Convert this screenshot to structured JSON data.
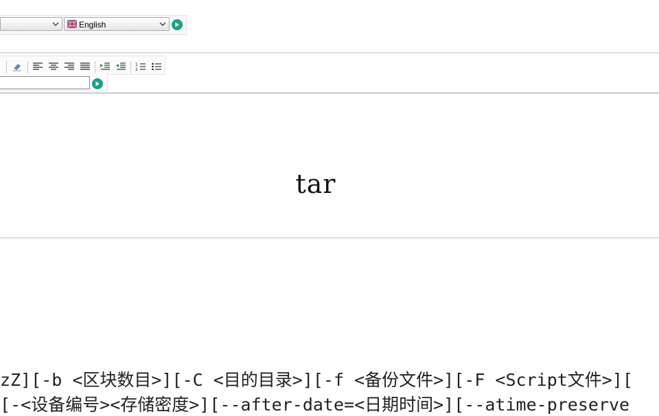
{
  "toolbar": {
    "language_select": {
      "value": "English"
    },
    "colors": {
      "accent": "#17a389"
    }
  },
  "format_toolbar": {
    "icons": [
      "eraser-icon",
      "align-left-icon",
      "align-center-icon",
      "align-right-icon",
      "align-justify-icon",
      "indent-increase-icon",
      "indent-decrease-icon",
      "ordered-list-icon",
      "unordered-list-icon"
    ]
  },
  "document": {
    "title": "tar",
    "syntax_line1": "zZ][-b <区块数目>][-C <目的目录>][-f <备份文件>][-F <Script文件>][",
    "syntax_line2": "[-<设备编号><存储密度>][--after-date=<日期时间>][--atime-preserve"
  }
}
